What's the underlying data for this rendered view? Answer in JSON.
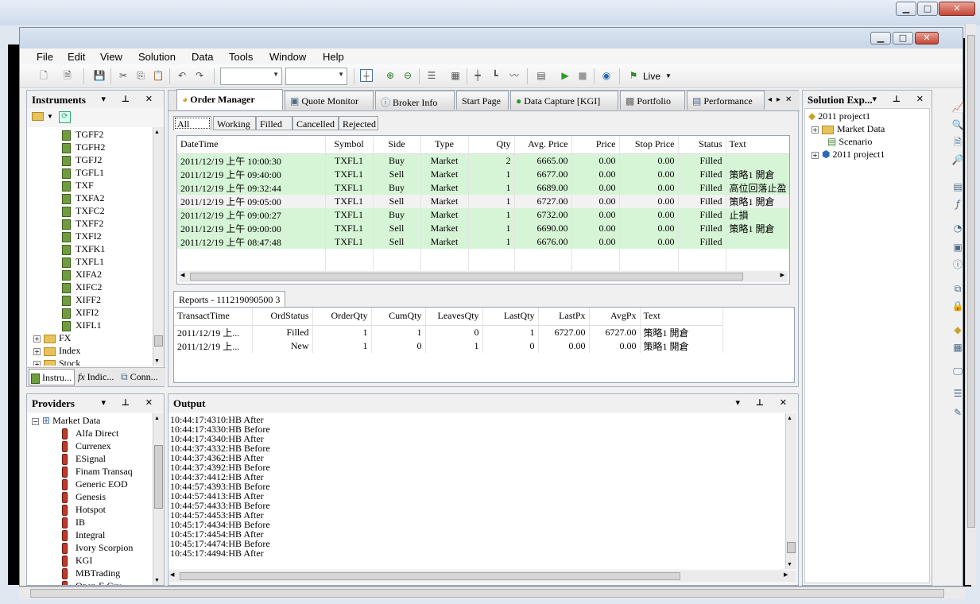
{
  "menu": [
    "File",
    "Edit",
    "View",
    "Solution",
    "Data",
    "Tools",
    "Window",
    "Help"
  ],
  "toolbar": {
    "live_label": "Live"
  },
  "instruments": {
    "title": "Instruments",
    "items": [
      "TGFF2",
      "TGFH2",
      "TGFJ2",
      "TGFL1",
      "TXF",
      "TXFA2",
      "TXFC2",
      "TXFF2",
      "TXFI2",
      "TXFK1",
      "TXFL1",
      "XIFA2",
      "XIFC2",
      "XIFF2",
      "XIFI2",
      "XIFL1"
    ],
    "folders": [
      "FX",
      "Index",
      "Stock"
    ],
    "bottom_tabs": [
      "Instru...",
      "Indic...",
      "Conn..."
    ]
  },
  "providers": {
    "title": "Providers",
    "root": "Market Data",
    "items": [
      "Alfa Direct",
      "Currenex",
      "ESignal",
      "Finam Transaq",
      "Generic EOD",
      "Genesis",
      "Hotspot",
      "IB",
      "Integral",
      "Ivory Scorpion",
      "KGI",
      "MBTrading",
      "Open E Cry"
    ]
  },
  "doc_tabs": [
    "Order Manager",
    "Quote Monitor",
    "Broker Info",
    "Start Page",
    "Data Capture [KGI]",
    "Portfolio",
    "Performance"
  ],
  "order_filters": [
    "All",
    "Working",
    "Filled",
    "Cancelled",
    "Rejected"
  ],
  "orders": {
    "columns": [
      "DateTime",
      "Symbol",
      "Side",
      "Type",
      "Qty",
      "Avg. Price",
      "Price",
      "Stop Price",
      "Status",
      "Text"
    ],
    "rows": [
      [
        "2011/12/19 上午 10:00:30",
        "TXFL1",
        "Buy",
        "Market",
        "2",
        "6665.00",
        "0.00",
        "0.00",
        "Filled",
        ""
      ],
      [
        "2011/12/19 上午 09:40:00",
        "TXFL1",
        "Sell",
        "Market",
        "1",
        "6677.00",
        "0.00",
        "0.00",
        "Filled",
        "策略1 開倉"
      ],
      [
        "2011/12/19 上午 09:32:44",
        "TXFL1",
        "Buy",
        "Market",
        "1",
        "6689.00",
        "0.00",
        "0.00",
        "Filled",
        "高位回落止盈"
      ],
      [
        "2011/12/19 上午 09:05:00",
        "TXFL1",
        "Sell",
        "Market",
        "1",
        "6727.00",
        "0.00",
        "0.00",
        "Filled",
        "策略1 開倉"
      ],
      [
        "2011/12/19 上午 09:00:27",
        "TXFL1",
        "Buy",
        "Market",
        "1",
        "6732.00",
        "0.00",
        "0.00",
        "Filled",
        "止損"
      ],
      [
        "2011/12/19 上午 09:00:00",
        "TXFL1",
        "Sell",
        "Market",
        "1",
        "6690.00",
        "0.00",
        "0.00",
        "Filled",
        "策略1 開倉"
      ],
      [
        "2011/12/19 上午 08:47:48",
        "TXFL1",
        "Sell",
        "Market",
        "1",
        "6676.00",
        "0.00",
        "0.00",
        "Filled",
        ""
      ]
    ],
    "selected_row": 3
  },
  "reports": {
    "tab": "Reports - 111219090500 3",
    "columns": [
      "TransactTime",
      "OrdStatus",
      "OrderQty",
      "CumQty",
      "LeavesQty",
      "LastQty",
      "LastPx",
      "AvgPx",
      "Text"
    ],
    "rows": [
      [
        "2011/12/19 上...",
        "Filled",
        "1",
        "1",
        "0",
        "1",
        "6727.00",
        "6727.00",
        "策略1 開倉"
      ],
      [
        "2011/12/19 上...",
        "New",
        "1",
        "0",
        "1",
        "0",
        "0.00",
        "0.00",
        "策略1 開倉"
      ]
    ]
  },
  "output": {
    "title": "Output",
    "lines": [
      "10:44:17:4310:HB After",
      "10:44:17:4330:HB Before",
      "10:44:17:4340:HB After",
      "10:44:37:4332:HB Before",
      "10:44:37:4362:HB After",
      "10:44:37:4392:HB Before",
      "10:44:37:4412:HB After",
      "10:44:57:4393:HB Before",
      "10:44:57:4413:HB After",
      "10:44:57:4433:HB Before",
      "10:44:57:4453:HB After",
      "10:45:17:4434:HB Before",
      "10:45:17:4454:HB After",
      "10:45:17:4474:HB Before",
      "10:45:17:4494:HB After"
    ]
  },
  "solution": {
    "title": "Solution Exp...",
    "root": "2011 project1",
    "children": [
      "Market Data",
      "Scenario",
      "2011 project1"
    ]
  }
}
